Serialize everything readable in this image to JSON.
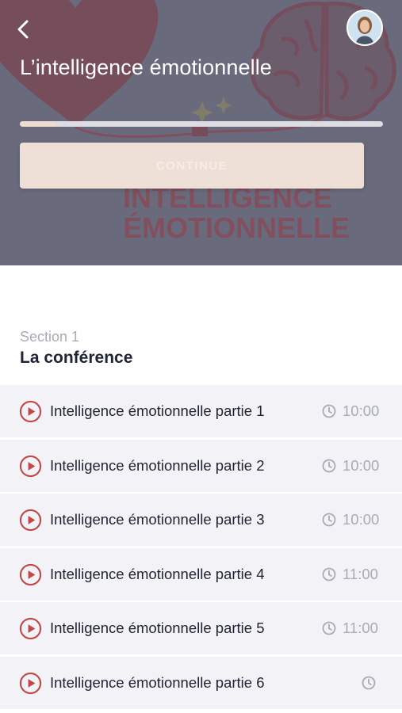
{
  "header": {
    "back_icon": "chevron-left-icon",
    "avatar_icon": "user-avatar",
    "title": "L’intelligence émotionnelle",
    "progress_fraction": 0.1,
    "continue_label": "CONTINUE"
  },
  "hero_image": {
    "text_line_1": "INTELLIGENCE",
    "text_line_2": "ÉMOTIONNELLE"
  },
  "section": {
    "kicker": "Section 1",
    "title": "La conférence"
  },
  "lessons": [
    {
      "title": "Intelligence émotionnelle partie 1",
      "duration": "10:00"
    },
    {
      "title": "Intelligence émotionnelle partie 2",
      "duration": "10:00"
    },
    {
      "title": "Intelligence émotionnelle partie 3",
      "duration": "10:00"
    },
    {
      "title": "Intelligence émotionnelle partie 4",
      "duration": "11:00"
    },
    {
      "title": "Intelligence émotionnelle partie 5",
      "duration": "11:00"
    },
    {
      "title": "Intelligence émotionnelle partie 6",
      "duration": ""
    }
  ],
  "icons": {
    "play": "play-circle-icon",
    "clock": "clock-icon"
  },
  "colors": {
    "accent_red": "#c14848",
    "hero_overlay": "#6b6e7e",
    "row_background": "#f3f3f7",
    "button_background": "#efe0d7"
  }
}
